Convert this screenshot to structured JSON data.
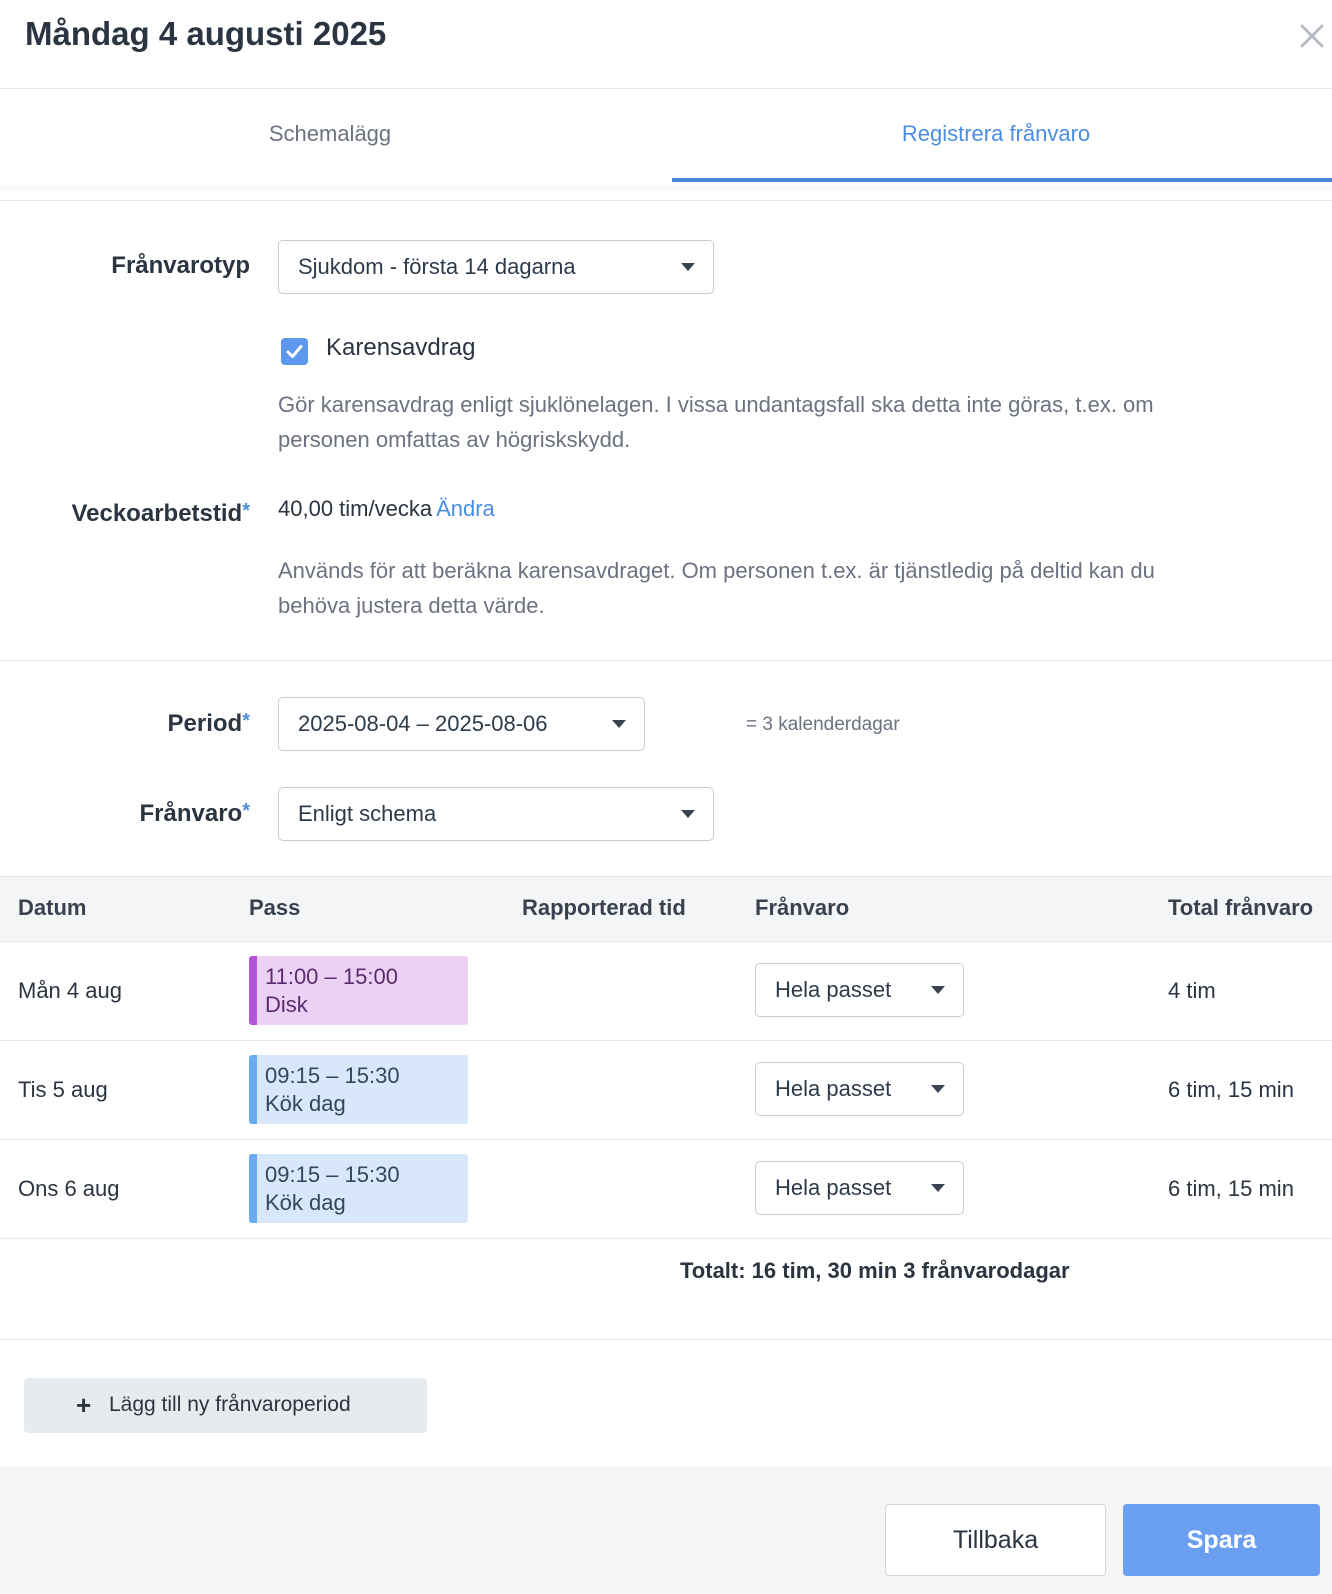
{
  "header": {
    "title": "Måndag 4 augusti 2025",
    "close_icon": "close-icon"
  },
  "tabs": [
    {
      "label": "Schemalägg",
      "active": false
    },
    {
      "label": "Registrera frånvaro",
      "active": true
    }
  ],
  "absence_type": {
    "label": "Frånvarotyp",
    "value": "Sjukdom - första 14 dagarna"
  },
  "karensavdrag": {
    "label": "Karensavdrag",
    "checked": true,
    "help": "Gör karensavdrag enligt sjuklönelagen. I vissa undantagsfall ska detta inte göras, t.ex. om personen omfattas av högriskskydd."
  },
  "weekly_hours": {
    "label": "Veckoarbetstid",
    "required_mark": "*",
    "value": "40,00 tim/vecka",
    "change_link": "Ändra",
    "help": "Används för att beräkna karensavdraget. Om personen t.ex. är tjänstledig på deltid kan du behöva justera detta värde."
  },
  "period": {
    "label": "Period",
    "required_mark": "*",
    "value": "2025-08-04 – 2025-08-06",
    "days_text": "= 3 kalenderdagar"
  },
  "absence": {
    "label": "Frånvaro",
    "required_mark": "*",
    "value": "Enligt schema"
  },
  "table": {
    "headers": [
      "Datum",
      "Pass",
      "Rapporterad tid",
      "Frånvaro",
      "Total frånvaro"
    ],
    "rows": [
      {
        "date": "Mån 4 aug",
        "shift_time": "11:00 – 15:00",
        "shift_name": "Disk",
        "shift_color": "#b455d9",
        "reported": "",
        "absence": "Hela passet",
        "total": "4 tim"
      },
      {
        "date": "Tis 5 aug",
        "shift_time": "09:15 – 15:30",
        "shift_name": "Kök dag",
        "shift_color": "#6aaaf0",
        "reported": "",
        "absence": "Hela passet",
        "total": "6 tim, 15 min"
      },
      {
        "date": "Ons 6 aug",
        "shift_time": "09:15 – 15:30",
        "shift_name": "Kök dag",
        "shift_color": "#6aaaf0",
        "reported": "",
        "absence": "Hela passet",
        "total": "6 tim, 15 min"
      }
    ],
    "totals": "Totalt: 16 tim, 30 min 3 frånvarodagar"
  },
  "add_period_button": {
    "icon": "plus-icon",
    "label": "Lägg till ny frånvaroperiod"
  },
  "footer": {
    "back_label": "Tillbaka",
    "save_label": "Spara"
  },
  "colors": {
    "accent": "#4a8de1",
    "save_button": "#6a9ef0"
  }
}
